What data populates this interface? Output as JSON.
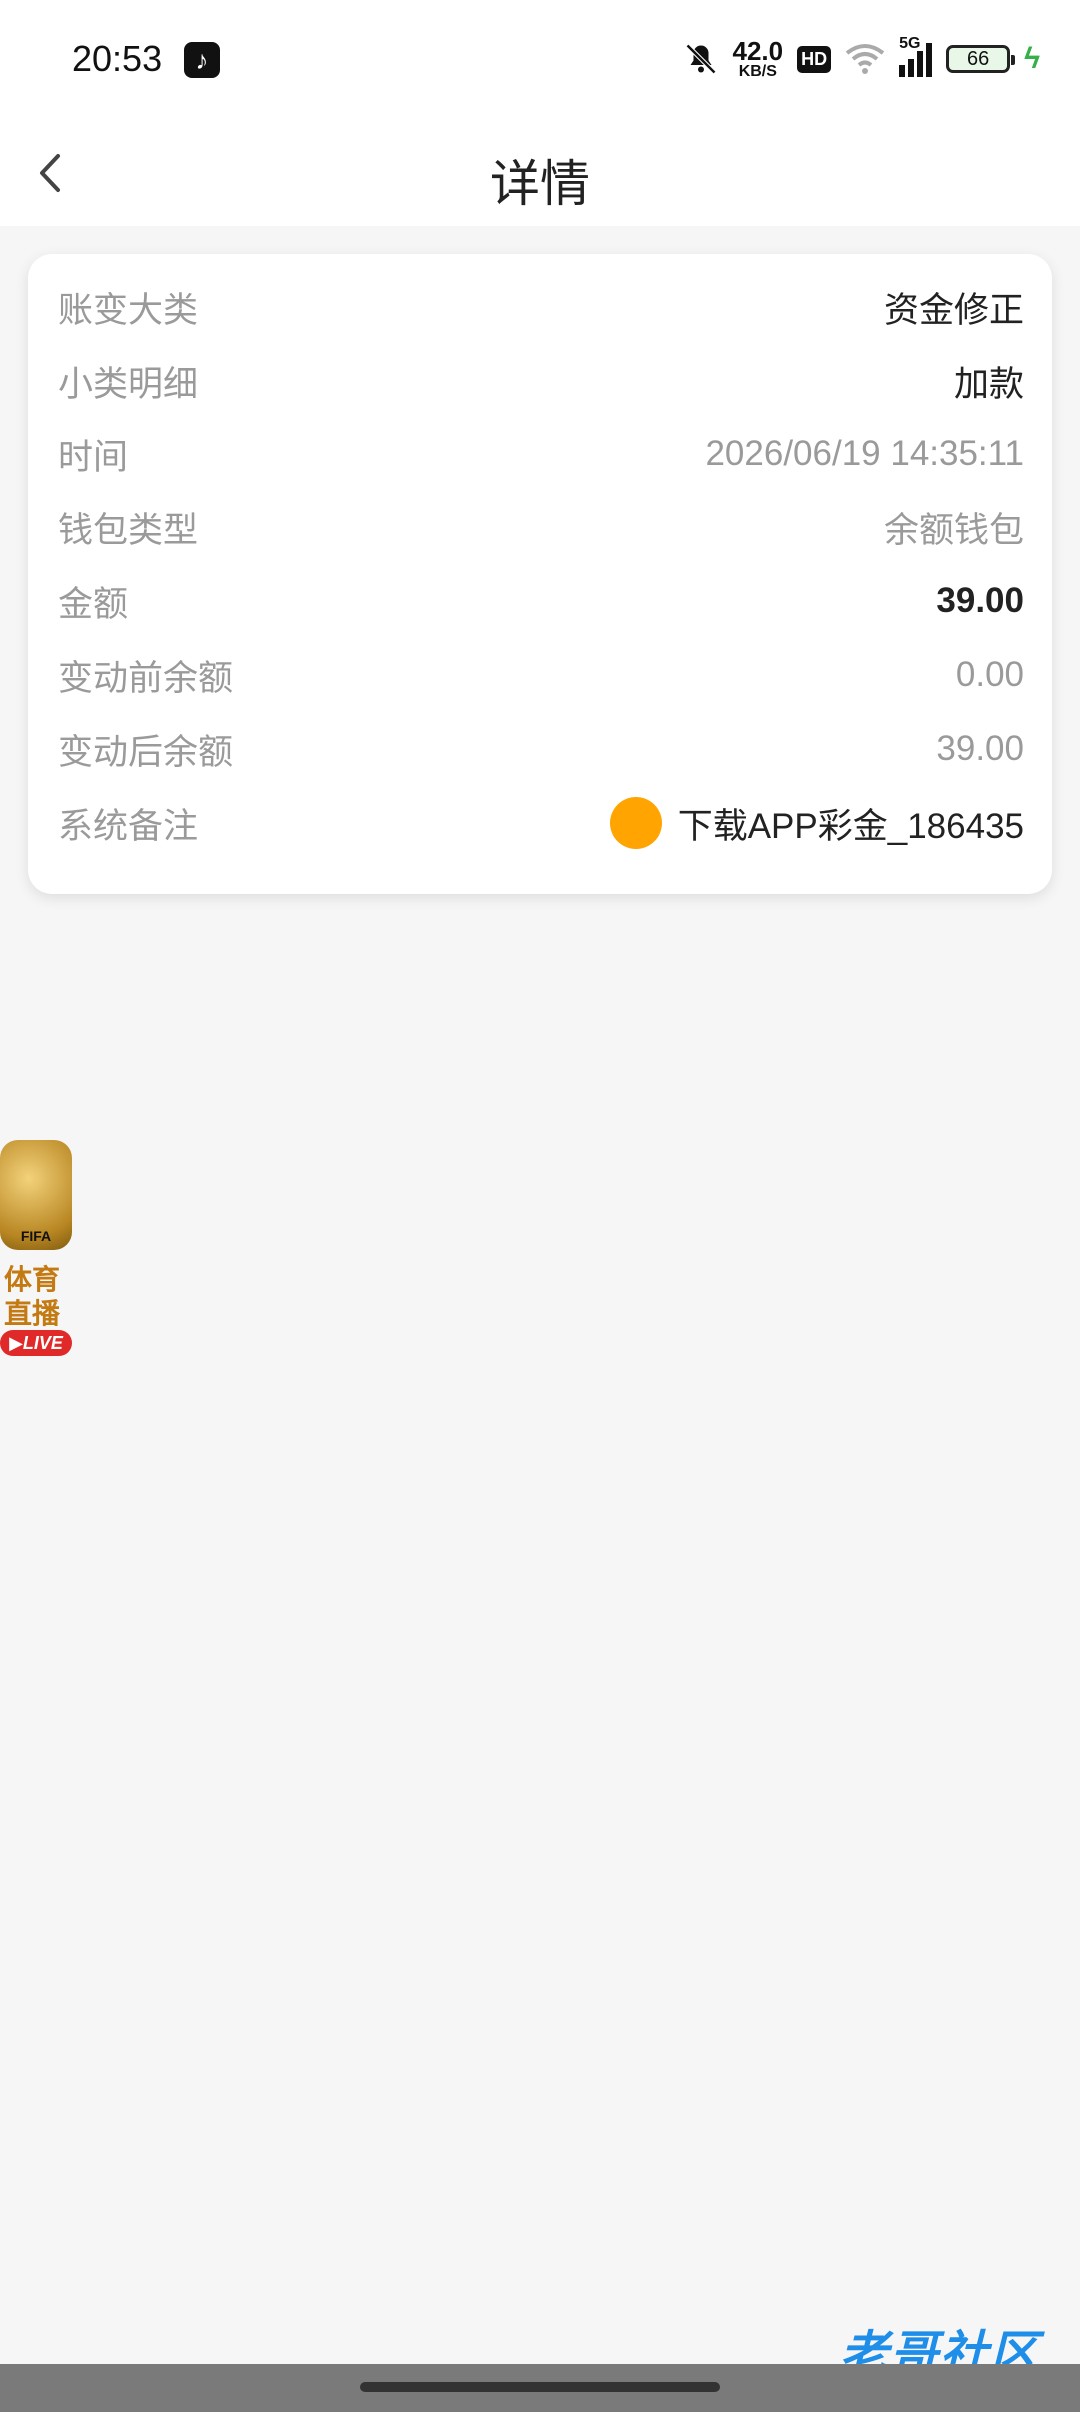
{
  "status_bar": {
    "time": "20:53",
    "tiktok_icon": "tiktok-icon",
    "net_speed_value": "42.0",
    "net_speed_unit": "KB/S",
    "hd_badge": "HD",
    "signal_label": "5G",
    "battery": "66"
  },
  "header": {
    "title": "详情"
  },
  "details": [
    {
      "label": "账变大类",
      "value": "资金修正"
    },
    {
      "label": "小类明细",
      "value": "加款"
    },
    {
      "label": "时间",
      "value": "2026/06/19 14:35:11"
    },
    {
      "label": "钱包类型",
      "value": "余额钱包"
    },
    {
      "label": "金额",
      "value": "39.00"
    },
    {
      "label": "变动前余额",
      "value": "0.00"
    },
    {
      "label": "变动后余额",
      "value": "39.00"
    },
    {
      "label": "系统备注",
      "value": "下载APP彩金_186435"
    }
  ],
  "float_badge": {
    "fifa_text": "FIFA",
    "line1": "体育",
    "line2": "直播",
    "live_text": "LIVE"
  },
  "watermark": "老哥社区",
  "colors": {
    "background": "#f6f6f6",
    "card": "#ffffff",
    "accent_orange": "#ffa400",
    "label_gray": "#9a9a9a",
    "value_dark": "#222222",
    "charging_green": "#35b04a"
  }
}
